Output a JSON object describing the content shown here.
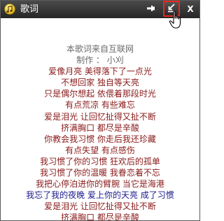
{
  "window": {
    "title": "歌词"
  },
  "titlebar": {
    "icons": {
      "app": "music-note-icon",
      "pin": "pin-icon",
      "dock": "dock-arrow-icon",
      "close": "close-icon"
    },
    "close_label": "X"
  },
  "colors": {
    "titlebar": "#2f2f2f",
    "highlight_border": "#e8281e",
    "lyric_red": "#8a1a1a",
    "lyric_blue": "#1a1a8a",
    "info_grey": "#6a6a6a"
  },
  "lyrics": {
    "lines": [
      {
        "text": "本歌词来自互联网",
        "tone": "grey"
      },
      {
        "text": "制作 ： 小刈",
        "tone": "grey"
      },
      {
        "text": "爱像月亮 美得落下了一点光",
        "tone": "red"
      },
      {
        "text": "不想回家 独自等天亮",
        "tone": "red"
      },
      {
        "text": "只是偶尔想起 依偎着那段时光",
        "tone": "red"
      },
      {
        "text": "有点荒凉 有些难忘",
        "tone": "red"
      },
      {
        "text": "爱是泪光 让回忆扯得又扯不断",
        "tone": "red"
      },
      {
        "text": "挤满胸口 都尽是辛酸",
        "tone": "red"
      },
      {
        "text": "你教会我习惯 你走后我还珍藏",
        "tone": "red"
      },
      {
        "text": "有点失望 有点感伤",
        "tone": "red"
      },
      {
        "text": "我习惯了你的习惯 狂欢后的孤单",
        "tone": "red"
      },
      {
        "text": "我习惯了你的温暖 我眷恋着不忘",
        "tone": "red"
      },
      {
        "text": "我把心停泊进你的臂腕 当它是海港",
        "tone": "red"
      },
      {
        "text": "我忘了我的夜晚 爱上你的天亮 成了习惯",
        "tone": "blue"
      },
      {
        "text": "爱是泪光 让回忆扯得又扯不断",
        "tone": "red"
      },
      {
        "text": "挤满胸口 都尽是辛酸",
        "tone": "red"
      }
    ]
  }
}
